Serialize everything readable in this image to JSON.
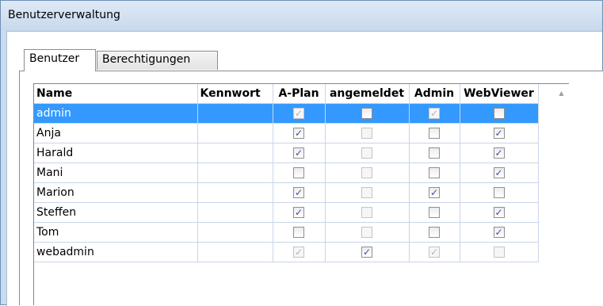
{
  "window": {
    "title": "Benutzerverwaltung"
  },
  "tabs": [
    {
      "label": "Benutzer",
      "active": true
    },
    {
      "label": "Berechtigungen",
      "active": false
    }
  ],
  "grid": {
    "columns": [
      "Name",
      "Kennwort",
      "A-Plan",
      "angemeldet",
      "Admin",
      "WebViewer"
    ],
    "rows": [
      {
        "name": "admin",
        "kennwort": "",
        "aplan": {
          "checked": true,
          "enabled": false
        },
        "angemeldet": {
          "checked": false,
          "enabled": true
        },
        "admin": {
          "checked": true,
          "enabled": false
        },
        "webviewer": {
          "checked": false,
          "enabled": true
        },
        "selected": true
      },
      {
        "name": "Anja",
        "kennwort": "",
        "aplan": {
          "checked": true,
          "enabled": true
        },
        "angemeldet": {
          "checked": false,
          "enabled": false
        },
        "admin": {
          "checked": false,
          "enabled": true
        },
        "webviewer": {
          "checked": true,
          "enabled": true
        },
        "selected": false
      },
      {
        "name": "Harald",
        "kennwort": "",
        "aplan": {
          "checked": true,
          "enabled": true
        },
        "angemeldet": {
          "checked": false,
          "enabled": false
        },
        "admin": {
          "checked": false,
          "enabled": true
        },
        "webviewer": {
          "checked": true,
          "enabled": true
        },
        "selected": false
      },
      {
        "name": "Mani",
        "kennwort": "",
        "aplan": {
          "checked": false,
          "enabled": true
        },
        "angemeldet": {
          "checked": false,
          "enabled": false
        },
        "admin": {
          "checked": false,
          "enabled": true
        },
        "webviewer": {
          "checked": true,
          "enabled": true
        },
        "selected": false
      },
      {
        "name": "Marion",
        "kennwort": "",
        "aplan": {
          "checked": true,
          "enabled": true
        },
        "angemeldet": {
          "checked": false,
          "enabled": false
        },
        "admin": {
          "checked": true,
          "enabled": true
        },
        "webviewer": {
          "checked": false,
          "enabled": true
        },
        "selected": false
      },
      {
        "name": "Steffen",
        "kennwort": "",
        "aplan": {
          "checked": true,
          "enabled": true
        },
        "angemeldet": {
          "checked": false,
          "enabled": false
        },
        "admin": {
          "checked": false,
          "enabled": true
        },
        "webviewer": {
          "checked": true,
          "enabled": true
        },
        "selected": false
      },
      {
        "name": "Tom",
        "kennwort": "",
        "aplan": {
          "checked": false,
          "enabled": true
        },
        "angemeldet": {
          "checked": false,
          "enabled": false
        },
        "admin": {
          "checked": false,
          "enabled": true
        },
        "webviewer": {
          "checked": true,
          "enabled": true
        },
        "selected": false
      },
      {
        "name": "webadmin",
        "kennwort": "",
        "aplan": {
          "checked": true,
          "enabled": false
        },
        "angemeldet": {
          "checked": true,
          "enabled": true
        },
        "admin": {
          "checked": true,
          "enabled": false
        },
        "webviewer": {
          "checked": false,
          "enabled": false
        },
        "selected": false
      }
    ]
  },
  "scrollbar": {
    "up_icon": "chevron-up-icon"
  },
  "colors": {
    "selection": "#3399ff",
    "grid_line": "#c9d6e8",
    "checkmark": "#3c4fa0"
  }
}
